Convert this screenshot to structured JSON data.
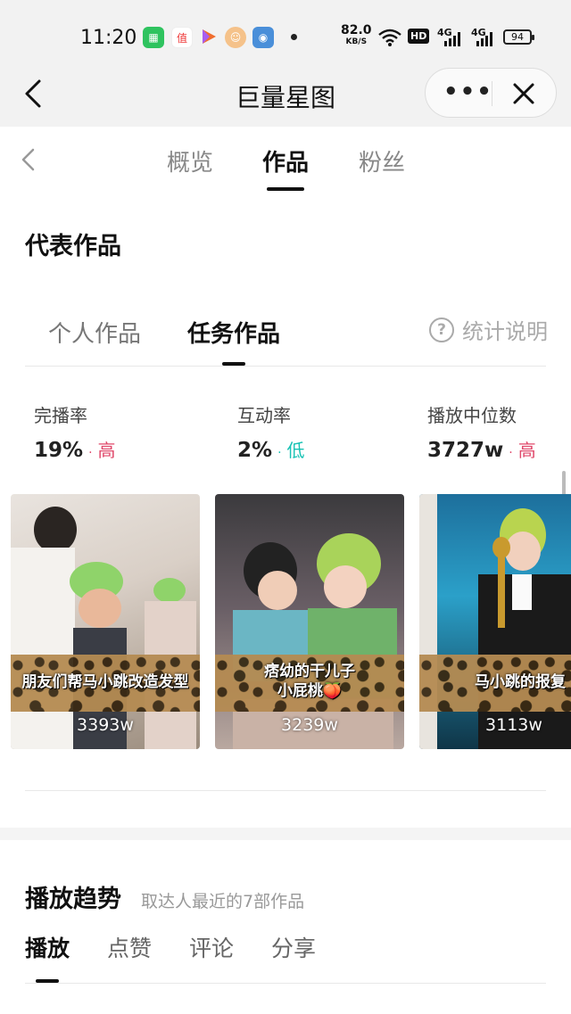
{
  "status_bar": {
    "time": "11:20",
    "speed_value": "82.0",
    "speed_unit": "KB/S",
    "network_hd": "HD",
    "network_1": "4G",
    "network_2": "4G",
    "battery": "94",
    "icons": [
      "app-green-icon",
      "app-red-icon",
      "video-play-icon",
      "avatar-app-icon",
      "game-app-icon",
      "more-dot-icon",
      "wifi-icon",
      "hd-icon",
      "signal-icon",
      "signal-icon",
      "battery-icon"
    ]
  },
  "titlebar": {
    "title": "巨量星图",
    "more": "•••"
  },
  "top_tabs": {
    "items": [
      {
        "label": "概览",
        "active": false
      },
      {
        "label": "作品",
        "active": true
      },
      {
        "label": "粉丝",
        "active": false
      }
    ]
  },
  "section": {
    "title": "代表作品"
  },
  "sub_tabs": {
    "items": [
      {
        "label": "个人作品",
        "active": false
      },
      {
        "label": "任务作品",
        "active": true
      }
    ],
    "help_glyph": "?",
    "help_label": "统计说明"
  },
  "metrics": [
    {
      "label": "完播率",
      "value": "19%",
      "dot": "·",
      "level": "高"
    },
    {
      "label": "互动率",
      "value": "2%",
      "dot": "·",
      "level": "低"
    },
    {
      "label": "播放中位数",
      "value": "3727w",
      "dot": "·",
      "level": "高"
    }
  ],
  "videos": [
    {
      "title_line1": "朋友们帮马小跳改造发型",
      "title_line2": "",
      "views": "3393w"
    },
    {
      "title_line1": "痞幼的干儿子",
      "title_line2": "小屁桃🍑",
      "views": "3239w"
    },
    {
      "title_line1": "马小跳的报复",
      "title_line2": "",
      "views": "3113w"
    }
  ],
  "trend": {
    "title": "播放趋势",
    "subtitle": "取达人最近的7部作品",
    "tabs": [
      {
        "label": "播放",
        "active": true
      },
      {
        "label": "点赞",
        "active": false
      },
      {
        "label": "评论",
        "active": false
      },
      {
        "label": "分享",
        "active": false
      }
    ]
  },
  "colors": {
    "high": "#e0486a",
    "low": "#17c2b4",
    "text_primary": "#111111",
    "text_secondary": "#888888"
  }
}
